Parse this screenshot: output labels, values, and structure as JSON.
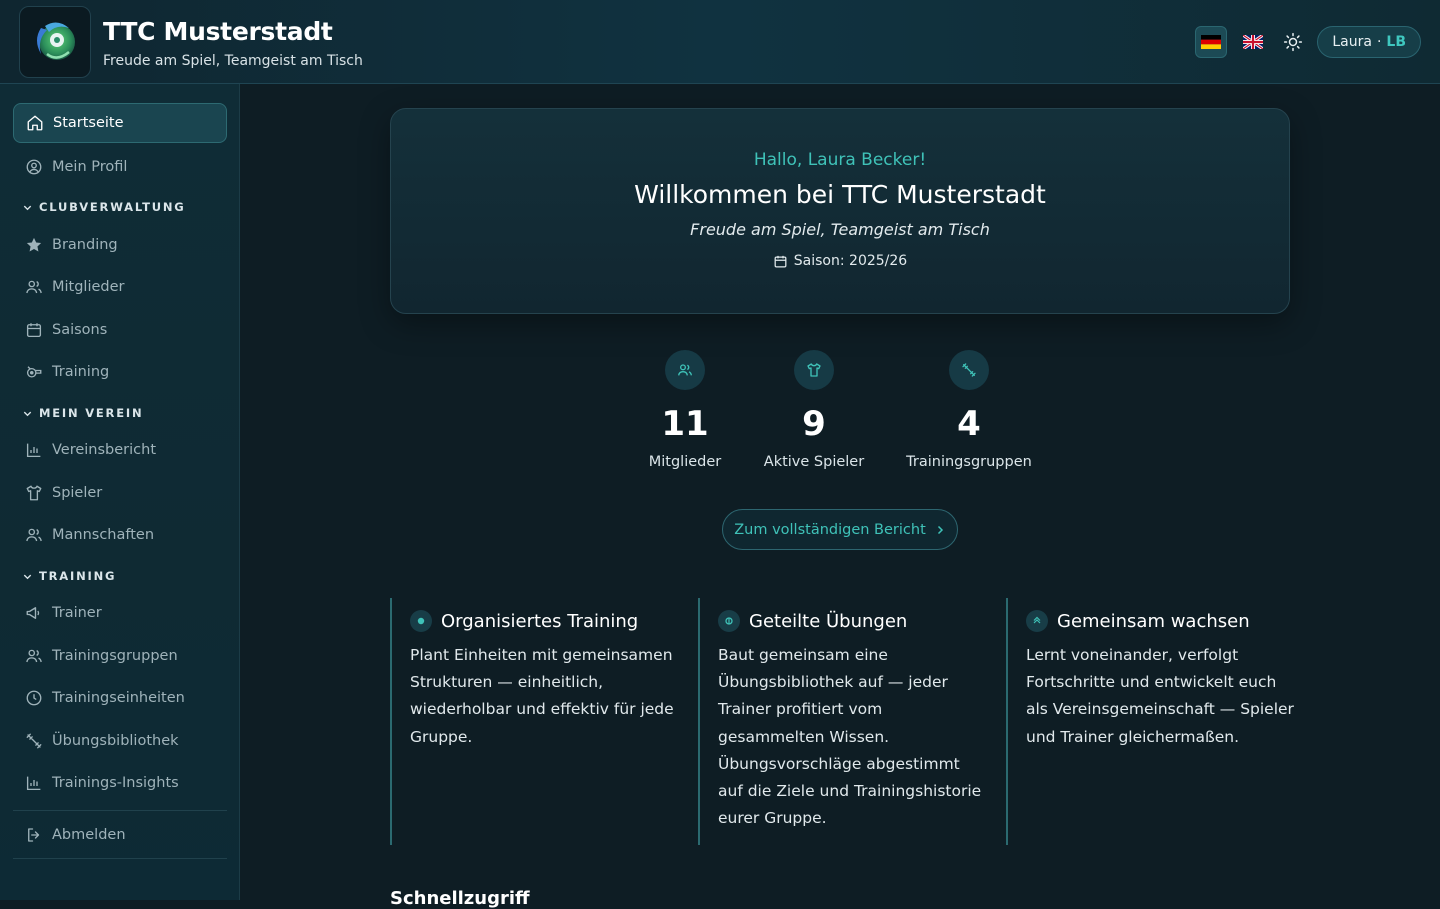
{
  "header": {
    "club_name": "TTC Musterstadt",
    "tagline": "Freude am Spiel, Teamgeist am Tisch",
    "languages": [
      {
        "code": "de",
        "flag": "🇩🇪",
        "active": true
      },
      {
        "code": "en",
        "flag": "🇬🇧",
        "active": false
      }
    ],
    "theme_icon": "sun-icon",
    "user": {
      "name": "Laura",
      "separator": "·",
      "initials": "LB"
    }
  },
  "sidebar": {
    "top_items": [
      {
        "label": "Startseite",
        "icon": "home-icon",
        "active": true
      },
      {
        "label": "Mein Profil",
        "icon": "profile-icon"
      }
    ],
    "sections": [
      {
        "title": "CLUBVERWALTUNG",
        "items": [
          {
            "label": "Branding",
            "icon": "star-icon"
          },
          {
            "label": "Mitglieder",
            "icon": "users-icon"
          },
          {
            "label": "Saisons",
            "icon": "calendar-icon"
          },
          {
            "label": "Training",
            "icon": "whistle-icon"
          }
        ]
      },
      {
        "title": "MEIN VEREIN",
        "items": [
          {
            "label": "Vereinsbericht",
            "icon": "bar-chart-icon"
          },
          {
            "label": "Spieler",
            "icon": "shirt-icon"
          },
          {
            "label": "Mannschaften",
            "icon": "users-icon"
          }
        ]
      },
      {
        "title": "TRAINING",
        "items": [
          {
            "label": "Trainer",
            "icon": "megaphone-icon"
          },
          {
            "label": "Trainingsgruppen",
            "icon": "users-icon"
          },
          {
            "label": "Trainingseinheiten",
            "icon": "clock-icon"
          },
          {
            "label": "Übungsbibliothek",
            "icon": "dumbbell-icon"
          },
          {
            "label": "Trainings-Insights",
            "icon": "bar-chart-icon"
          }
        ]
      }
    ],
    "logout": {
      "label": "Abmelden",
      "icon": "logout-icon"
    }
  },
  "hero": {
    "greeting": "Hallo, Laura Becker!",
    "welcome": "Willkommen bei TTC Musterstadt",
    "motto": "Freude am Spiel, Teamgeist am Tisch",
    "season": "Saison: 2025/26"
  },
  "stats": [
    {
      "value": "11",
      "label": "Mitglieder",
      "icon": "users-icon"
    },
    {
      "value": "9",
      "label": "Aktive Spieler",
      "icon": "shirt-icon"
    },
    {
      "value": "4",
      "label": "Trainingsgruppen",
      "icon": "dumbbell-icon"
    }
  ],
  "report_button": {
    "label": "Zum vollständigen Bericht",
    "icon": "chevron-right-icon"
  },
  "features": [
    {
      "title": "Organisiertes Training",
      "text": "Plant Einheiten mit gemeinsamen Strukturen — einheitlich, wiederholbar und effektiv für jede Gruppe."
    },
    {
      "title": "Geteilte Übungen",
      "text": "Baut gemeinsam eine Übungsbibliothek auf — jeder Trainer profitiert vom gesammelten Wissen. Übungsvorschläge abgestimmt auf die Ziele und Trainingshistorie eurer Gruppe."
    },
    {
      "title": "Gemeinsam wachsen",
      "text": "Lernt voneinander, verfolgt Fortschritte und entwickelt euch als Vereinsgemeinschaft — Spieler und Trainer gleichermaßen."
    }
  ],
  "quick_access": {
    "title": "Schnellzugriff"
  },
  "colors": {
    "accent": "#3fc2b8",
    "background": "#0e1d24",
    "sidebar": "#0f2a33"
  }
}
